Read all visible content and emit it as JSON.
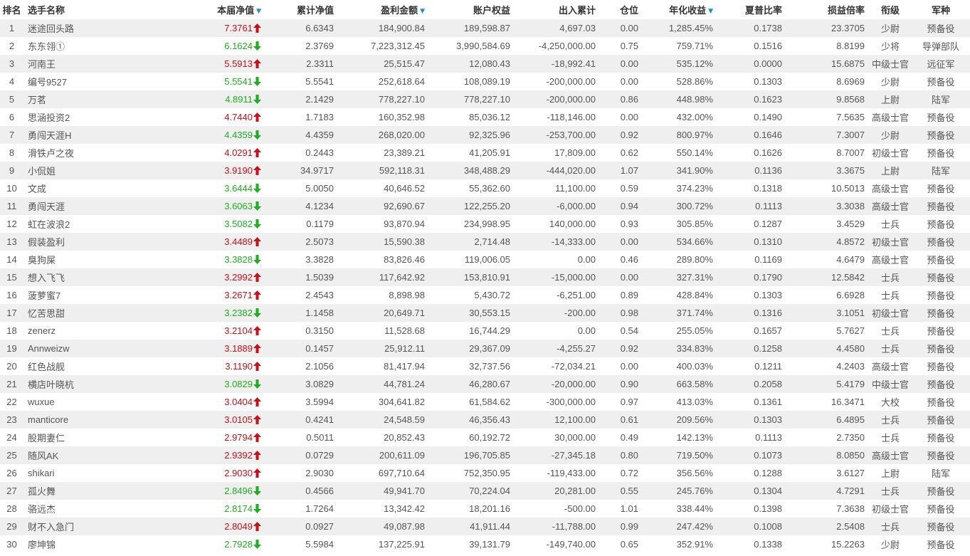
{
  "headers": {
    "rank": "排名",
    "name": "选手名称",
    "nav": "本届净值",
    "cum_nav": "累计净值",
    "profit": "盈利金额",
    "equity": "账户权益",
    "inout": "出入累计",
    "position": "仓位",
    "annual": "年化收益",
    "sharpe": "夏普比率",
    "pl_ratio": "损益倍率",
    "rank_title": "衔级",
    "corps": "军种"
  },
  "sort_indicator": "▼",
  "colors": {
    "up": "#c8101a",
    "down": "#1fae1f",
    "sort": "#1a8fd6",
    "stripe": "#efefef"
  },
  "rows": [
    {
      "rank": "1",
      "name": "迷途回头路",
      "nav": "7.3761",
      "trend": "up",
      "cum_nav": "6.6343",
      "profit": "184,900.84",
      "equity": "189,598.87",
      "inout": "4,697.03",
      "position": "0.00",
      "annual": "1,285.45%",
      "sharpe": "0.1738",
      "pl_ratio": "23.3705",
      "rank_title": "少尉",
      "corps": "预备役"
    },
    {
      "rank": "2",
      "name": "东东翎①",
      "nav": "6.1624",
      "trend": "down",
      "cum_nav": "2.3769",
      "profit": "7,223,312.45",
      "equity": "3,990,584.69",
      "inout": "-4,250,000.00",
      "position": "0.75",
      "annual": "759.71%",
      "sharpe": "0.1516",
      "pl_ratio": "8.8199",
      "rank_title": "少将",
      "corps": "导弹部队"
    },
    {
      "rank": "3",
      "name": "河南王",
      "nav": "5.5913",
      "trend": "up",
      "cum_nav": "2.3311",
      "profit": "25,515.47",
      "equity": "12,080.43",
      "inout": "-18,992.41",
      "position": "0.00",
      "annual": "535.12%",
      "sharpe": "0.0000",
      "pl_ratio": "15.6875",
      "rank_title": "中级士官",
      "corps": "远征军"
    },
    {
      "rank": "4",
      "name": "编号9527",
      "nav": "5.5541",
      "trend": "down",
      "cum_nav": "5.5541",
      "profit": "252,618.64",
      "equity": "108,089.19",
      "inout": "-200,000.00",
      "position": "0.00",
      "annual": "528.86%",
      "sharpe": "0.1303",
      "pl_ratio": "8.6969",
      "rank_title": "少尉",
      "corps": "预备役"
    },
    {
      "rank": "5",
      "name": "万茗",
      "nav": "4.8911",
      "trend": "down",
      "cum_nav": "2.1429",
      "profit": "778,227.10",
      "equity": "778,227.10",
      "inout": "-200,000.00",
      "position": "0.86",
      "annual": "448.98%",
      "sharpe": "0.1623",
      "pl_ratio": "9.8568",
      "rank_title": "上尉",
      "corps": "陆军"
    },
    {
      "rank": "6",
      "name": "思涵投资2",
      "nav": "4.7440",
      "trend": "up",
      "cum_nav": "1.7183",
      "profit": "160,352.98",
      "equity": "85,036.12",
      "inout": "-118,146.00",
      "position": "0.00",
      "annual": "432.00%",
      "sharpe": "0.1490",
      "pl_ratio": "7.5635",
      "rank_title": "高级士官",
      "corps": "预备役"
    },
    {
      "rank": "7",
      "name": "勇闯天涯H",
      "nav": "4.4359",
      "trend": "down",
      "cum_nav": "4.4359",
      "profit": "268,020.00",
      "equity": "92,325.96",
      "inout": "-253,700.00",
      "position": "0.92",
      "annual": "800.97%",
      "sharpe": "0.1646",
      "pl_ratio": "7.3007",
      "rank_title": "少尉",
      "corps": "预备役"
    },
    {
      "rank": "8",
      "name": "滑铁卢之夜",
      "nav": "4.0291",
      "trend": "up",
      "cum_nav": "0.2443",
      "profit": "23,389.21",
      "equity": "41,205.91",
      "inout": "17,809.00",
      "position": "0.62",
      "annual": "550.14%",
      "sharpe": "0.1626",
      "pl_ratio": "8.7007",
      "rank_title": "初级士官",
      "corps": "预备役"
    },
    {
      "rank": "9",
      "name": "小侃姐",
      "nav": "3.9190",
      "trend": "up",
      "cum_nav": "34.9717",
      "profit": "592,118.31",
      "equity": "348,488.29",
      "inout": "-444,020.00",
      "position": "1.07",
      "annual": "341.90%",
      "sharpe": "0.1136",
      "pl_ratio": "3.3675",
      "rank_title": "上尉",
      "corps": "陆军"
    },
    {
      "rank": "10",
      "name": "文成",
      "nav": "3.6444",
      "trend": "down",
      "cum_nav": "5.0050",
      "profit": "40,646.52",
      "equity": "55,362.60",
      "inout": "11,100.00",
      "position": "0.59",
      "annual": "374.23%",
      "sharpe": "0.1318",
      "pl_ratio": "10.5013",
      "rank_title": "高级士官",
      "corps": "预备役"
    },
    {
      "rank": "11",
      "name": "勇闯天涯",
      "nav": "3.6063",
      "trend": "down",
      "cum_nav": "4.1234",
      "profit": "92,690.67",
      "equity": "122,255.20",
      "inout": "-6,000.00",
      "position": "0.94",
      "annual": "300.72%",
      "sharpe": "0.1113",
      "pl_ratio": "3.3038",
      "rank_title": "高级士官",
      "corps": "预备役"
    },
    {
      "rank": "12",
      "name": "虹在波浪2",
      "nav": "3.5082",
      "trend": "down",
      "cum_nav": "0.1179",
      "profit": "93,870.94",
      "equity": "234,998.95",
      "inout": "140,000.00",
      "position": "0.93",
      "annual": "305.85%",
      "sharpe": "0.1287",
      "pl_ratio": "3.4529",
      "rank_title": "士兵",
      "corps": "预备役"
    },
    {
      "rank": "13",
      "name": "假装盈利",
      "nav": "3.4489",
      "trend": "up",
      "cum_nav": "2.5073",
      "profit": "15,590.38",
      "equity": "2,714.48",
      "inout": "-14,333.00",
      "position": "0.00",
      "annual": "534.66%",
      "sharpe": "0.1310",
      "pl_ratio": "4.8572",
      "rank_title": "初级士官",
      "corps": "预备役"
    },
    {
      "rank": "14",
      "name": "臭狗屎",
      "nav": "3.3828",
      "trend": "down",
      "cum_nav": "3.3828",
      "profit": "83,826.46",
      "equity": "119,006.05",
      "inout": "0.00",
      "position": "0.46",
      "annual": "289.80%",
      "sharpe": "0.1169",
      "pl_ratio": "4.6479",
      "rank_title": "高级士官",
      "corps": "预备役"
    },
    {
      "rank": "15",
      "name": "想入飞飞",
      "nav": "3.2992",
      "trend": "up",
      "cum_nav": "1.5039",
      "profit": "117,642.92",
      "equity": "153,810.91",
      "inout": "-15,000.00",
      "position": "0.00",
      "annual": "327.31%",
      "sharpe": "0.1790",
      "pl_ratio": "12.5842",
      "rank_title": "士兵",
      "corps": "预备役"
    },
    {
      "rank": "16",
      "name": "菠萝蜜7",
      "nav": "3.2671",
      "trend": "up",
      "cum_nav": "2.4543",
      "profit": "8,898.98",
      "equity": "5,430.72",
      "inout": "-6,251.00",
      "position": "0.89",
      "annual": "428.84%",
      "sharpe": "0.1303",
      "pl_ratio": "6.6928",
      "rank_title": "士兵",
      "corps": "预备役"
    },
    {
      "rank": "17",
      "name": "忆苦思甜",
      "nav": "3.2382",
      "trend": "down",
      "cum_nav": "1.1458",
      "profit": "20,649.71",
      "equity": "30,553.15",
      "inout": "-200.00",
      "position": "0.98",
      "annual": "371.74%",
      "sharpe": "0.1316",
      "pl_ratio": "3.1051",
      "rank_title": "初级士官",
      "corps": "预备役"
    },
    {
      "rank": "18",
      "name": "zenerz",
      "nav": "3.2104",
      "trend": "up",
      "cum_nav": "0.3150",
      "profit": "11,528.68",
      "equity": "16,744.29",
      "inout": "0.00",
      "position": "0.54",
      "annual": "255.05%",
      "sharpe": "0.1657",
      "pl_ratio": "5.7627",
      "rank_title": "士兵",
      "corps": "预备役"
    },
    {
      "rank": "19",
      "name": "Annweizw",
      "nav": "3.1889",
      "trend": "up",
      "cum_nav": "0.1457",
      "profit": "25,912.11",
      "equity": "29,367.09",
      "inout": "-4,255.27",
      "position": "0.92",
      "annual": "334.83%",
      "sharpe": "0.1258",
      "pl_ratio": "4.4580",
      "rank_title": "士兵",
      "corps": "预备役"
    },
    {
      "rank": "20",
      "name": "红色战舰",
      "nav": "3.1190",
      "trend": "up",
      "cum_nav": "2.1056",
      "profit": "81,417.94",
      "equity": "32,737.56",
      "inout": "-72,034.21",
      "position": "0.00",
      "annual": "400.03%",
      "sharpe": "0.1211",
      "pl_ratio": "4.2403",
      "rank_title": "高级士官",
      "corps": "预备役"
    },
    {
      "rank": "21",
      "name": "横店叶晓杭",
      "nav": "3.0829",
      "trend": "down",
      "cum_nav": "3.0829",
      "profit": "44,781.24",
      "equity": "46,280.67",
      "inout": "-20,000.00",
      "position": "0.90",
      "annual": "663.58%",
      "sharpe": "0.2058",
      "pl_ratio": "5.4179",
      "rank_title": "中级士官",
      "corps": "预备役"
    },
    {
      "rank": "22",
      "name": "wuxue",
      "nav": "3.0404",
      "trend": "up",
      "cum_nav": "3.5994",
      "profit": "304,641.82",
      "equity": "61,584.62",
      "inout": "-300,000.00",
      "position": "0.97",
      "annual": "413.03%",
      "sharpe": "0.1361",
      "pl_ratio": "16.3471",
      "rank_title": "大校",
      "corps": "预备役"
    },
    {
      "rank": "23",
      "name": "manticore",
      "nav": "3.0105",
      "trend": "up",
      "cum_nav": "0.4241",
      "profit": "24,548.59",
      "equity": "46,356.43",
      "inout": "12,100.00",
      "position": "0.61",
      "annual": "209.56%",
      "sharpe": "0.1303",
      "pl_ratio": "6.4895",
      "rank_title": "士兵",
      "corps": "预备役"
    },
    {
      "rank": "24",
      "name": "股期妻仁",
      "nav": "2.9794",
      "trend": "up",
      "cum_nav": "0.5011",
      "profit": "20,852.43",
      "equity": "60,192.72",
      "inout": "30,000.00",
      "position": "0.49",
      "annual": "142.13%",
      "sharpe": "0.1113",
      "pl_ratio": "2.7350",
      "rank_title": "士兵",
      "corps": "预备役"
    },
    {
      "rank": "25",
      "name": "随风AK",
      "nav": "2.9392",
      "trend": "up",
      "cum_nav": "0.0729",
      "profit": "200,611.09",
      "equity": "196,705.85",
      "inout": "-27,345.18",
      "position": "0.80",
      "annual": "719.50%",
      "sharpe": "0.1073",
      "pl_ratio": "8.0850",
      "rank_title": "高级士官",
      "corps": "预备役"
    },
    {
      "rank": "26",
      "name": "shikari",
      "nav": "2.9030",
      "trend": "up",
      "cum_nav": "2.9030",
      "profit": "697,710.64",
      "equity": "752,350.95",
      "inout": "-119,433.00",
      "position": "0.72",
      "annual": "356.56%",
      "sharpe": "0.1288",
      "pl_ratio": "3.6127",
      "rank_title": "上尉",
      "corps": "陆军"
    },
    {
      "rank": "27",
      "name": "孤火舞",
      "nav": "2.8496",
      "trend": "down",
      "cum_nav": "0.4566",
      "profit": "49,941.70",
      "equity": "70,224.04",
      "inout": "20,281.00",
      "position": "0.55",
      "annual": "245.76%",
      "sharpe": "0.1304",
      "pl_ratio": "4.7291",
      "rank_title": "士兵",
      "corps": "预备役"
    },
    {
      "rank": "28",
      "name": "骆远杰",
      "nav": "2.8174",
      "trend": "down",
      "cum_nav": "1.7264",
      "profit": "13,342.42",
      "equity": "18,201.16",
      "inout": "-500.00",
      "position": "1.01",
      "annual": "338.44%",
      "sharpe": "0.1398",
      "pl_ratio": "7.3638",
      "rank_title": "初级士官",
      "corps": "预备役"
    },
    {
      "rank": "29",
      "name": "财不入急门",
      "nav": "2.8049",
      "trend": "up",
      "cum_nav": "0.0927",
      "profit": "49,087.98",
      "equity": "41,911.44",
      "inout": "-11,788.00",
      "position": "0.99",
      "annual": "247.42%",
      "sharpe": "0.1008",
      "pl_ratio": "2.5408",
      "rank_title": "士兵",
      "corps": "预备役"
    },
    {
      "rank": "30",
      "name": "廖坤锦",
      "nav": "2.7928",
      "trend": "down",
      "cum_nav": "5.5984",
      "profit": "137,225.91",
      "equity": "39,131.79",
      "inout": "-149,740.00",
      "position": "0.65",
      "annual": "352.91%",
      "sharpe": "0.1338",
      "pl_ratio": "15.2263",
      "rank_title": "少尉",
      "corps": "预备役"
    }
  ]
}
